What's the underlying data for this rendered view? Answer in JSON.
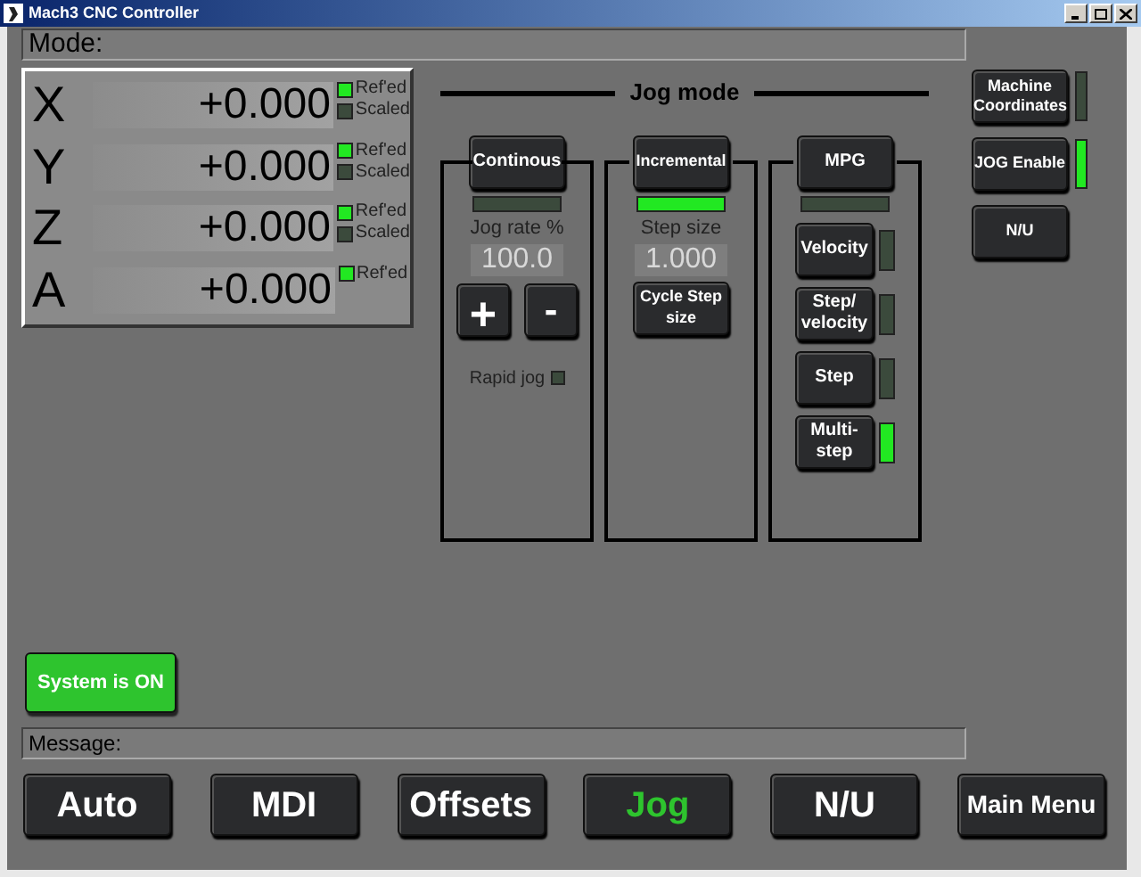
{
  "window": {
    "title": "Mach3 CNC Controller"
  },
  "mode": {
    "label": "Mode:"
  },
  "axes": [
    {
      "letter": "X",
      "value": "+0.000",
      "indicators": [
        {
          "label": "Ref'ed",
          "on": true
        },
        {
          "label": "Scaled",
          "on": false
        }
      ]
    },
    {
      "letter": "Y",
      "value": "+0.000",
      "indicators": [
        {
          "label": "Ref'ed",
          "on": true
        },
        {
          "label": "Scaled",
          "on": false
        }
      ]
    },
    {
      "letter": "Z",
      "value": "+0.000",
      "indicators": [
        {
          "label": "Ref'ed",
          "on": true
        },
        {
          "label": "Scaled",
          "on": false
        }
      ]
    },
    {
      "letter": "A",
      "value": "+0.000",
      "indicators": [
        {
          "label": "Ref'ed",
          "on": true
        }
      ]
    }
  ],
  "jog": {
    "title": "Jog mode",
    "continuous": {
      "button": "Continous",
      "on": false,
      "rate_label": "Jog rate %",
      "rate": "100.0",
      "plus": "+",
      "minus": "-",
      "rapid_label": "Rapid jog",
      "rapid_on": false
    },
    "incremental": {
      "button": "Incremental",
      "on": true,
      "step_label": "Step size",
      "step": "1.000",
      "cycle_button": "Cycle Step size"
    },
    "mpg": {
      "button": "MPG",
      "on": false,
      "modes": [
        {
          "label": "Velocity",
          "on": false
        },
        {
          "label": "Step/ velocity",
          "on": false
        },
        {
          "label": "Step",
          "on": false
        },
        {
          "label": "Multi- step",
          "on": true
        }
      ]
    }
  },
  "side_buttons": [
    {
      "label": "Machine Coordinates",
      "on": false
    },
    {
      "label": "JOG Enable",
      "on": true
    },
    {
      "label": "N/U"
    }
  ],
  "system": {
    "label": "System is ON",
    "on": true
  },
  "message": {
    "label": "Message:"
  },
  "nav": [
    {
      "label": "Auto",
      "selected": false
    },
    {
      "label": "MDI",
      "selected": false
    },
    {
      "label": "Offsets",
      "selected": false
    },
    {
      "label": "Jog",
      "selected": true
    },
    {
      "label": "N/U",
      "selected": false
    },
    {
      "label": "Main Menu",
      "selected": false
    }
  ]
}
